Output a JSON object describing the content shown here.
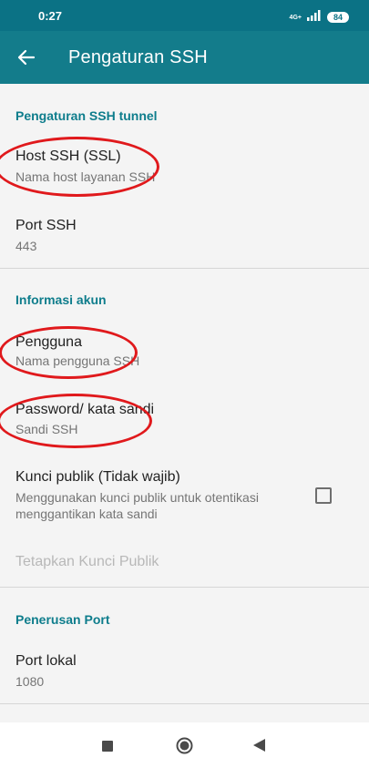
{
  "status_bar": {
    "time": "0:27",
    "network": "4G+",
    "battery": "84"
  },
  "app_bar": {
    "title": "Pengaturan SSH",
    "back_icon": "arrow-left-icon"
  },
  "sections": {
    "ssh_tunnel": {
      "header": "Pengaturan SSH tunnel",
      "host": {
        "title": "Host SSH (SSL)",
        "summary": "Nama host layanan SSH"
      },
      "port": {
        "title": "Port SSH",
        "summary": "443"
      }
    },
    "account": {
      "header": "Informasi akun",
      "user": {
        "title": "Pengguna",
        "summary": "Nama pengguna SSH"
      },
      "password": {
        "title": "Password/ kata sandi",
        "summary": "Sandi SSH"
      },
      "public_key": {
        "title": "Kunci publik (Tidak wajib)",
        "summary_line1": "Menggunakan kunci publik untuk otentikasi",
        "summary_line2": "menggantikan kata sandi",
        "checked": false
      },
      "set_public_key": {
        "title": "Tetapkan Kunci Publik",
        "enabled": false
      }
    },
    "port_forwarding": {
      "header": "Penerusan Port",
      "local_port": {
        "title": "Port lokal",
        "summary": "1080"
      }
    }
  },
  "nav_bar": {
    "icons": [
      "square-icon",
      "circle-icon",
      "triangle-back-icon"
    ]
  },
  "colors": {
    "status_bar": "#0b7285",
    "app_bar": "#137c8b",
    "accent": "#0e7d8c",
    "annotation": "#e0191c",
    "background": "#f4f4f4"
  }
}
